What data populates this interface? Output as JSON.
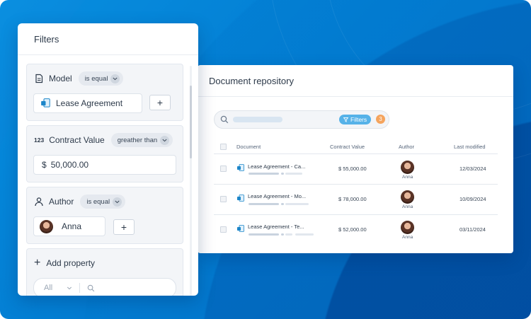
{
  "filters_panel": {
    "title": "Filters",
    "model": {
      "label": "Model",
      "operator": "is equal",
      "value": "Lease Agreement"
    },
    "contract_value": {
      "icon_text": "123",
      "label": "Contract Value",
      "operator": "greather than",
      "currency": "$",
      "value": "50,000.00"
    },
    "author": {
      "label": "Author",
      "operator": "is equal",
      "value": "Anna"
    },
    "add_property": {
      "label": "Add property"
    },
    "footer": {
      "select_value": "All"
    }
  },
  "repository": {
    "title": "Document repository",
    "search": {
      "filters_label": "Filters",
      "filter_count": "3"
    },
    "columns": [
      "Document",
      "Contract Value",
      "Author",
      "Last modified"
    ],
    "rows": [
      {
        "document": "Lease Agreement - Ca...",
        "value": "$ 55,000.00",
        "author": "Anna",
        "modified": "12/03/2024"
      },
      {
        "document": "Lease Agreement - Mo...",
        "value": "$ 78,000.00",
        "author": "Anna",
        "modified": "10/09/2024"
      },
      {
        "document": "Lease Agreement - Te...",
        "value": "$ 52,000.00",
        "author": "Anna",
        "modified": "03/11/2024"
      }
    ]
  },
  "colors": {
    "accent": "#56b2e8",
    "badge": "#f5a45d",
    "background": "#0a8fe0"
  }
}
